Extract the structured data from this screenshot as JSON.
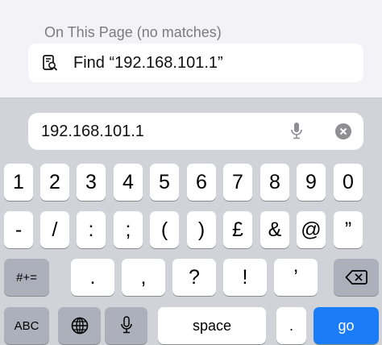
{
  "find_panel": {
    "section_title": "On This Page (no matches)",
    "find_item": "Find “192.168.101.1”",
    "find_icon": "document-search-icon"
  },
  "search_field": {
    "value": "192.168.101.1",
    "mic_icon": "microphone-icon",
    "clear_icon": "clear-circle-icon"
  },
  "keyboard": {
    "row1": [
      "1",
      "2",
      "3",
      "4",
      "5",
      "6",
      "7",
      "8",
      "9",
      "0"
    ],
    "row2": [
      "-",
      "/",
      ":",
      ";",
      "(",
      ")",
      "£",
      "&",
      "@",
      "”"
    ],
    "row3": {
      "mode": "#+=",
      "keys": [
        ".",
        ",",
        "?",
        "!",
        "’"
      ],
      "backspace_icon": "backspace-icon"
    },
    "row4": {
      "abc": "ABC",
      "globe_icon": "globe-icon",
      "mic_icon": "microphone-icon",
      "space": "space",
      "period": ".",
      "go": "go"
    }
  },
  "colors": {
    "go_key": "#1a7cf7",
    "keyboard_bg": "#d1d3d9",
    "dark_key": "#abb0ba"
  }
}
